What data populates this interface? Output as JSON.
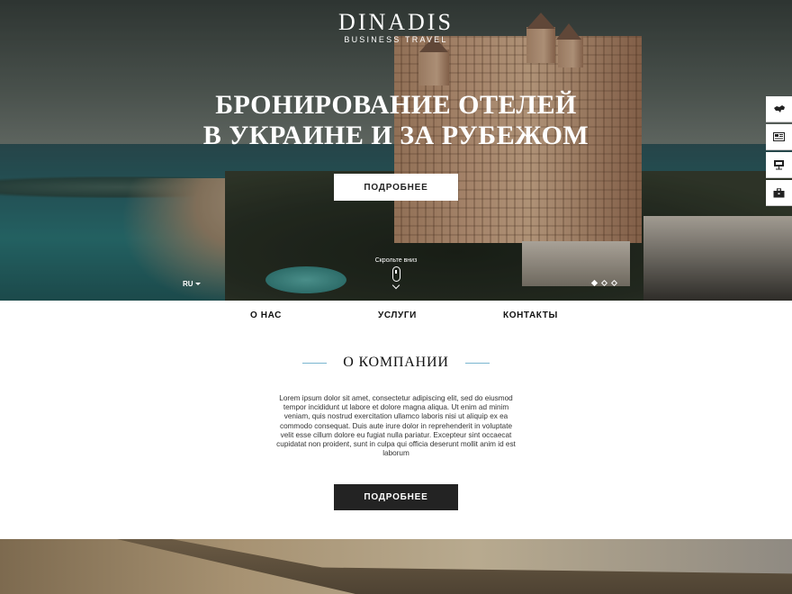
{
  "header": {
    "logo_name": "DINADIS",
    "logo_sub": "BUSINESS TRAVEL"
  },
  "hero": {
    "title_line1": "БРОНИРОВАНИЕ ОТЕЛЕЙ",
    "title_line2": "В УКРАИНЕ И ЗА РУБЕЖОМ",
    "button_label": "ПОДРОБНЕЕ",
    "scroll_text": "Скрольте вниз",
    "language": "RU",
    "slider": {
      "total": 3,
      "active": 1
    }
  },
  "side_bar": {
    "items": [
      "map-ukraine-icon",
      "newspaper-icon",
      "presentation-icon",
      "briefcase-icon"
    ]
  },
  "nav": {
    "items": [
      "О НАС",
      "УСЛУГИ",
      "КОНТАКТЫ"
    ]
  },
  "about": {
    "title": "О КОМПАНИИ",
    "text": "Lorem ipsum dolor sit amet, consectetur adipiscing elit, sed do eiusmod tempor incididunt ut labore et dolore magna aliqua. Ut enim ad minim veniam, quis nostrud exercitation ullamco laboris nisi ut aliquip ex ea commodo consequat. Duis aute irure dolor in reprehenderit in voluptate velit esse cillum dolore eu fugiat nulla pariatur. Excepteur sint occaecat cupidatat non proident, sunt in culpa qui officia deserunt mollit anim id est laborum",
    "button_label": "ПОДРОБНЕЕ"
  },
  "colors": {
    "accent_line": "#7ab6d0",
    "dark_button": "#232323"
  }
}
